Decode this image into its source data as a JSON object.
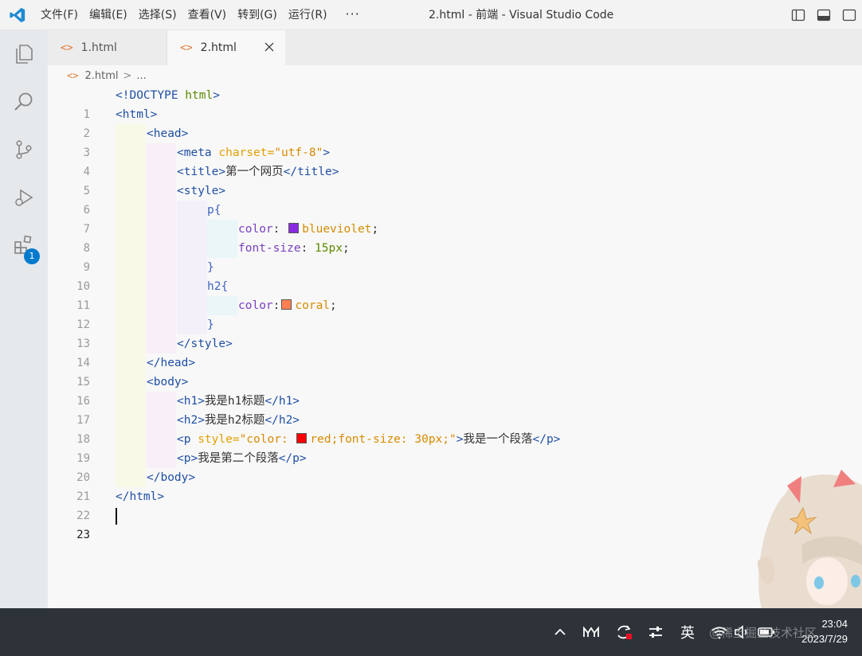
{
  "titlebar": {
    "menu": [
      "文件(F)",
      "编辑(E)",
      "选择(S)",
      "查看(V)",
      "转到(G)",
      "运行(R)"
    ],
    "more": "···",
    "window_title": "2.html - 前端 - Visual Studio Code"
  },
  "activity": {
    "extensions_badge": "1"
  },
  "tabs": [
    {
      "label": "1.html",
      "icon": "<>"
    },
    {
      "label": "2.html",
      "icon": "<>"
    }
  ],
  "breadcrumb": {
    "file": "2.html",
    "sep": ">",
    "rest": "..."
  },
  "editor": {
    "line_numbers": [
      "1",
      "2",
      "3",
      "4",
      "5",
      "6",
      "7",
      "8",
      "9",
      "10",
      "11",
      "12",
      "13",
      "14",
      "15",
      "16",
      "17",
      "18",
      "19",
      "20",
      "21",
      "22",
      "23"
    ],
    "code": {
      "l1a": "<!DOCTYPE",
      "l1b": " html",
      "l1c": ">",
      "l2": "<html>",
      "l3": "<head>",
      "l4a": "<meta",
      "l4b": " charset=",
      "l4c": "\"utf-8\"",
      "l4d": ">",
      "l5a": "<title>",
      "l5b": "第一个网页",
      "l5c": "</title>",
      "l6": "<style>",
      "l7": "p{",
      "l8a": "color",
      "l8b": ": ",
      "l8c": "blueviolet",
      "l8d": ";",
      "l9a": "font-size",
      "l9b": ": ",
      "l9c": "15px",
      "l9d": ";",
      "l10": "}",
      "l11": "h2{",
      "l12a": "color",
      "l12b": ":",
      "l12c": "coral",
      "l12d": ";",
      "l13": "}",
      "l14": "</style>",
      "l15": "</head>",
      "l16": "<body>",
      "l17a": "<h1>",
      "l17b": "我是h1标题",
      "l17c": "</h1>",
      "l18a": "<h2>",
      "l18b": "我是h2标题",
      "l18c": "</h2>",
      "l19a": "<p",
      "l19b": " style=",
      "l19c": "\"color: ",
      "l19d": "red;font-size: 30px;\"",
      "l19e": ">",
      "l19f": "我是一个段落",
      "l19g": "</p>",
      "l20a": "<p>",
      "l20b": "我是第二个段落",
      "l20c": "</p>",
      "l21": "</body>",
      "l22": "</html>"
    },
    "swatches": {
      "blueviolet": "#8a2be2",
      "coral": "#ff7f50",
      "red": "#ff0000"
    }
  },
  "taskbar": {
    "ime": "英",
    "time": "23:04",
    "date": "2023/7/29",
    "watermark": "@稀土掘金技术社区"
  }
}
